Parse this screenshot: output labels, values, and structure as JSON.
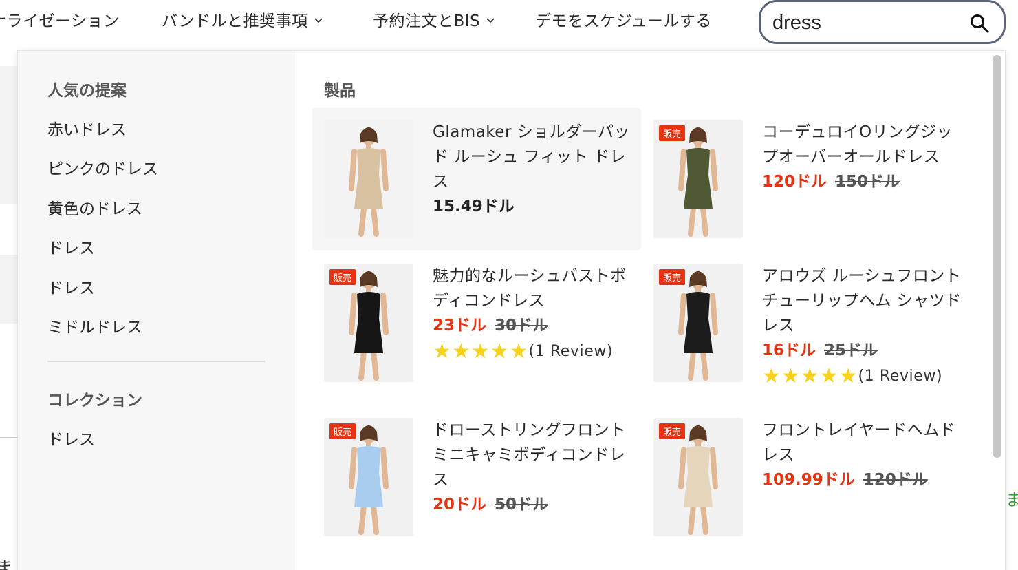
{
  "nav": {
    "items": [
      {
        "label": "ナライゼーション"
      },
      {
        "label": "バンドルと推奨事項"
      },
      {
        "label": "予約注文とBIS"
      },
      {
        "label": "デモをスケジュールする"
      }
    ],
    "search": {
      "value": "dress"
    }
  },
  "suggestions": {
    "title": "人気の提案",
    "items": [
      "赤いドレス",
      "ピンクのドレス",
      "黄色のドレス",
      "ドレス",
      "ドレス",
      "ミドルドレス"
    ]
  },
  "collections": {
    "title": "コレクション",
    "items": [
      "ドレス"
    ]
  },
  "products": {
    "title": "製品",
    "items": [
      {
        "name": "Glamaker ショルダーパッド ルーシュ フィット ドレス",
        "price": "15.49ドル",
        "compare": "",
        "badge": "",
        "rating": "",
        "review": "",
        "dress_color": "#d9c2a2",
        "bg_color": "#f3f3f3"
      },
      {
        "name": "コーデュロイOリングジップオーバーオールドレス",
        "price": "120ドル",
        "compare": "150ドル",
        "badge": "販売",
        "rating": "",
        "review": "",
        "dress_color": "#4f5a34",
        "bg_color": "#f1f1f1"
      },
      {
        "name": "魅力的なルーシュバストボディコンドレス",
        "price": "23ドル",
        "compare": "30ドル",
        "badge": "販売",
        "rating": "★★★★★",
        "review": "(1 Review)",
        "dress_color": "#161616",
        "bg_color": "#f1f1f1"
      },
      {
        "name": "アロウズ ルーシュフロント チューリップヘム シャツドレス",
        "price": "16ドル",
        "compare": "25ドル",
        "badge": "販売",
        "rating": "★★★★★",
        "review": "(1 Review)",
        "dress_color": "#1c1c1c",
        "bg_color": "#f1f1f1"
      },
      {
        "name": "ドローストリングフロントミニキャミボディコンドレス",
        "price": "20ドル",
        "compare": "50ドル",
        "badge": "販売",
        "rating": "",
        "review": "",
        "dress_color": "#a9cdee",
        "bg_color": "#f1f1f1"
      },
      {
        "name": "フロントレイヤードヘムドレス",
        "price": "109.99ドル",
        "compare": "120ドル",
        "badge": "販売",
        "rating": "",
        "review": "",
        "dress_color": "#e4d5bb",
        "bg_color": "#f1f1f1"
      }
    ]
  },
  "colors": {
    "sale_red": "#e63312",
    "star_yellow": "#f7d21b",
    "search_border": "#5a6478",
    "suggest_bg": "#f7f7f7"
  },
  "background_fragments": {
    "right_text": "ま",
    "bottom_text": "ま"
  }
}
